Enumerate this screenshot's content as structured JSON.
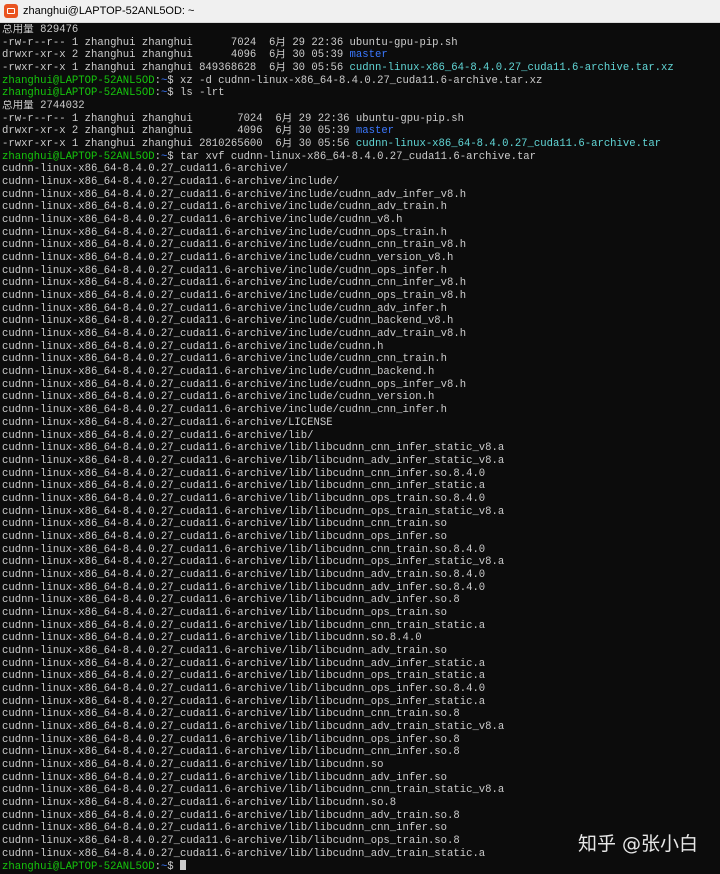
{
  "window": {
    "title": "zhanghui@LAPTOP-52ANL5OD: ~",
    "icon": "ubuntu-terminal-icon"
  },
  "watermark": "知乎 @张小白",
  "colors": {
    "prompt": "#16c60c",
    "directory": "#3b78ff",
    "archive": "#61d6d6",
    "text": "#cccccc",
    "background": "#0c0c0c"
  },
  "terminal": {
    "lines": [
      "总用量 829476",
      "-rw-r--r-- 1 zhanghui zhanghui      7024  6月 29 22:36 ubuntu-gpu-pip.sh",
      [
        "drwxr-xr-x 2 zhanghui zhanghui      4096  6月 30 05:39 ",
        {
          "c": "blue",
          "t": "master"
        }
      ],
      [
        "-rwxr-xr-x 1 zhanghui zhanghui 849368628  6月 30 05:56 ",
        {
          "c": "cyan",
          "t": "cudnn-linux-x86_64-8.4.0.27_cuda11.6-archive.tar.xz"
        }
      ],
      [
        {
          "c": "green",
          "t": "zhanghui@LAPTOP-52ANL5OD"
        },
        ":",
        {
          "c": "blue",
          "t": "~"
        },
        "$ xz -d cudnn-linux-x86_64-8.4.0.27_cuda11.6-archive.tar.xz"
      ],
      [
        {
          "c": "green",
          "t": "zhanghui@LAPTOP-52ANL5OD"
        },
        ":",
        {
          "c": "blue",
          "t": "~"
        },
        "$ ls -lrt"
      ],
      "总用量 2744032",
      "-rw-r--r-- 1 zhanghui zhanghui       7024  6月 29 22:36 ubuntu-gpu-pip.sh",
      [
        "drwxr-xr-x 2 zhanghui zhanghui       4096  6月 30 05:39 ",
        {
          "c": "blue",
          "t": "master"
        }
      ],
      [
        "-rwxr-xr-x 1 zhanghui zhanghui 2810265600  6月 30 05:56 ",
        {
          "c": "cyan",
          "t": "cudnn-linux-x86_64-8.4.0.27_cuda11.6-archive.tar"
        }
      ],
      [
        {
          "c": "green",
          "t": "zhanghui@LAPTOP-52ANL5OD"
        },
        ":",
        {
          "c": "blue",
          "t": "~"
        },
        "$ tar xvf cudnn-linux-x86_64-8.4.0.27_cuda11.6-archive.tar"
      ],
      "cudnn-linux-x86_64-8.4.0.27_cuda11.6-archive/",
      "cudnn-linux-x86_64-8.4.0.27_cuda11.6-archive/include/",
      "cudnn-linux-x86_64-8.4.0.27_cuda11.6-archive/include/cudnn_adv_infer_v8.h",
      "cudnn-linux-x86_64-8.4.0.27_cuda11.6-archive/include/cudnn_adv_train.h",
      "cudnn-linux-x86_64-8.4.0.27_cuda11.6-archive/include/cudnn_v8.h",
      "cudnn-linux-x86_64-8.4.0.27_cuda11.6-archive/include/cudnn_ops_train.h",
      "cudnn-linux-x86_64-8.4.0.27_cuda11.6-archive/include/cudnn_cnn_train_v8.h",
      "cudnn-linux-x86_64-8.4.0.27_cuda11.6-archive/include/cudnn_version_v8.h",
      "cudnn-linux-x86_64-8.4.0.27_cuda11.6-archive/include/cudnn_ops_infer.h",
      "cudnn-linux-x86_64-8.4.0.27_cuda11.6-archive/include/cudnn_cnn_infer_v8.h",
      "cudnn-linux-x86_64-8.4.0.27_cuda11.6-archive/include/cudnn_ops_train_v8.h",
      "cudnn-linux-x86_64-8.4.0.27_cuda11.6-archive/include/cudnn_adv_infer.h",
      "cudnn-linux-x86_64-8.4.0.27_cuda11.6-archive/include/cudnn_backend_v8.h",
      "cudnn-linux-x86_64-8.4.0.27_cuda11.6-archive/include/cudnn_adv_train_v8.h",
      "cudnn-linux-x86_64-8.4.0.27_cuda11.6-archive/include/cudnn.h",
      "cudnn-linux-x86_64-8.4.0.27_cuda11.6-archive/include/cudnn_cnn_train.h",
      "cudnn-linux-x86_64-8.4.0.27_cuda11.6-archive/include/cudnn_backend.h",
      "cudnn-linux-x86_64-8.4.0.27_cuda11.6-archive/include/cudnn_ops_infer_v8.h",
      "cudnn-linux-x86_64-8.4.0.27_cuda11.6-archive/include/cudnn_version.h",
      "cudnn-linux-x86_64-8.4.0.27_cuda11.6-archive/include/cudnn_cnn_infer.h",
      "cudnn-linux-x86_64-8.4.0.27_cuda11.6-archive/LICENSE",
      "cudnn-linux-x86_64-8.4.0.27_cuda11.6-archive/lib/",
      "cudnn-linux-x86_64-8.4.0.27_cuda11.6-archive/lib/libcudnn_cnn_infer_static_v8.a",
      "cudnn-linux-x86_64-8.4.0.27_cuda11.6-archive/lib/libcudnn_adv_infer_static_v8.a",
      "cudnn-linux-x86_64-8.4.0.27_cuda11.6-archive/lib/libcudnn_cnn_infer.so.8.4.0",
      "cudnn-linux-x86_64-8.4.0.27_cuda11.6-archive/lib/libcudnn_cnn_infer_static.a",
      "cudnn-linux-x86_64-8.4.0.27_cuda11.6-archive/lib/libcudnn_ops_train.so.8.4.0",
      "cudnn-linux-x86_64-8.4.0.27_cuda11.6-archive/lib/libcudnn_ops_train_static_v8.a",
      "cudnn-linux-x86_64-8.4.0.27_cuda11.6-archive/lib/libcudnn_cnn_train.so",
      "cudnn-linux-x86_64-8.4.0.27_cuda11.6-archive/lib/libcudnn_ops_infer.so",
      "cudnn-linux-x86_64-8.4.0.27_cuda11.6-archive/lib/libcudnn_cnn_train.so.8.4.0",
      "cudnn-linux-x86_64-8.4.0.27_cuda11.6-archive/lib/libcudnn_ops_infer_static_v8.a",
      "cudnn-linux-x86_64-8.4.0.27_cuda11.6-archive/lib/libcudnn_adv_train.so.8.4.0",
      "cudnn-linux-x86_64-8.4.0.27_cuda11.6-archive/lib/libcudnn_adv_infer.so.8.4.0",
      "cudnn-linux-x86_64-8.4.0.27_cuda11.6-archive/lib/libcudnn_adv_infer.so.8",
      "cudnn-linux-x86_64-8.4.0.27_cuda11.6-archive/lib/libcudnn_ops_train.so",
      "cudnn-linux-x86_64-8.4.0.27_cuda11.6-archive/lib/libcudnn_cnn_train_static.a",
      "cudnn-linux-x86_64-8.4.0.27_cuda11.6-archive/lib/libcudnn.so.8.4.0",
      "cudnn-linux-x86_64-8.4.0.27_cuda11.6-archive/lib/libcudnn_adv_train.so",
      "cudnn-linux-x86_64-8.4.0.27_cuda11.6-archive/lib/libcudnn_adv_infer_static.a",
      "cudnn-linux-x86_64-8.4.0.27_cuda11.6-archive/lib/libcudnn_ops_train_static.a",
      "cudnn-linux-x86_64-8.4.0.27_cuda11.6-archive/lib/libcudnn_ops_infer.so.8.4.0",
      "cudnn-linux-x86_64-8.4.0.27_cuda11.6-archive/lib/libcudnn_ops_infer_static.a",
      "cudnn-linux-x86_64-8.4.0.27_cuda11.6-archive/lib/libcudnn_cnn_train.so.8",
      "cudnn-linux-x86_64-8.4.0.27_cuda11.6-archive/lib/libcudnn_adv_train_static_v8.a",
      "cudnn-linux-x86_64-8.4.0.27_cuda11.6-archive/lib/libcudnn_ops_infer.so.8",
      "cudnn-linux-x86_64-8.4.0.27_cuda11.6-archive/lib/libcudnn_cnn_infer.so.8",
      "cudnn-linux-x86_64-8.4.0.27_cuda11.6-archive/lib/libcudnn.so",
      "cudnn-linux-x86_64-8.4.0.27_cuda11.6-archive/lib/libcudnn_adv_infer.so",
      "cudnn-linux-x86_64-8.4.0.27_cuda11.6-archive/lib/libcudnn_cnn_train_static_v8.a",
      "cudnn-linux-x86_64-8.4.0.27_cuda11.6-archive/lib/libcudnn.so.8",
      "cudnn-linux-x86_64-8.4.0.27_cuda11.6-archive/lib/libcudnn_adv_train.so.8",
      "cudnn-linux-x86_64-8.4.0.27_cuda11.6-archive/lib/libcudnn_cnn_infer.so",
      "cudnn-linux-x86_64-8.4.0.27_cuda11.6-archive/lib/libcudnn_ops_train.so.8",
      "cudnn-linux-x86_64-8.4.0.27_cuda11.6-archive/lib/libcudnn_adv_train_static.a",
      [
        {
          "c": "green",
          "t": "zhanghui@LAPTOP-52ANL5OD"
        },
        ":",
        {
          "c": "blue",
          "t": "~"
        },
        "$ ",
        {
          "cursor": true
        }
      ]
    ]
  }
}
